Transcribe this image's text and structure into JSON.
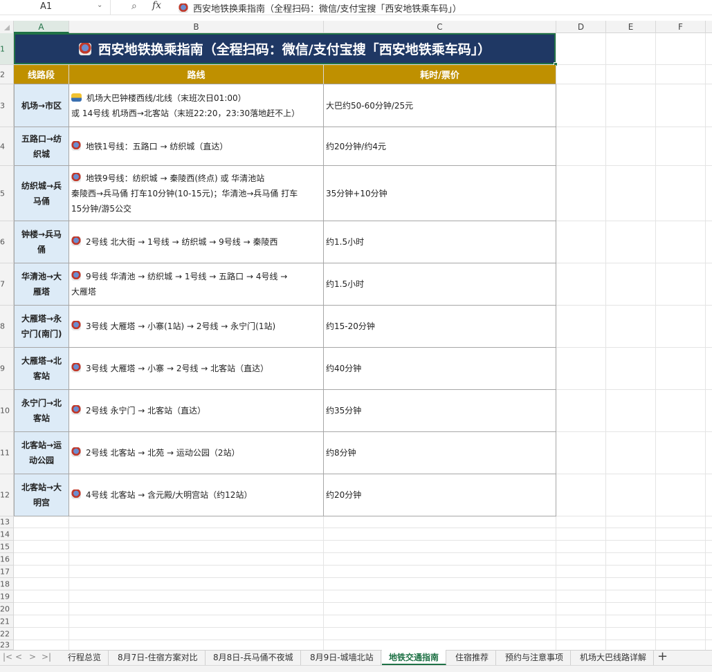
{
  "formula_bar": {
    "namebox": "A1",
    "zoom_icon": "⌕",
    "fx_label": "fx",
    "formula": "西安地铁换乘指南（全程扫码：微信/支付宝搜「西安地铁乘车码」）"
  },
  "columns": [
    "A",
    "B",
    "C",
    "D",
    "E",
    "F"
  ],
  "rows": [
    "1",
    "2",
    "3",
    "4",
    "5",
    "6",
    "7",
    "8",
    "9",
    "10",
    "11",
    "12",
    "13",
    "14",
    "15",
    "16",
    "17",
    "18",
    "19",
    "20",
    "21",
    "22",
    "23"
  ],
  "title": "西安地铁换乘指南（全程扫码：微信/支付宝搜「西安地铁乘车码」）",
  "headers": {
    "segment": "线路段",
    "route": "路线",
    "time_fare": "耗时/票价"
  },
  "table": [
    {
      "segment": [
        "机场→市区"
      ],
      "icon": "bus-icon",
      "route": [
        "机场大巴钟楼西线/北线（末班次日01:00）",
        "或 14号线 机场西→北客站（末班22:20，23:30落地赶不上）"
      ],
      "time_fare": "大巴约50-60分钟/25元"
    },
    {
      "segment": [
        "五路口→纺",
        "织城"
      ],
      "icon": "metro-icon",
      "route": [
        "地铁1号线：五路口 → 纺织城（直达）"
      ],
      "time_fare": "约20分钟/约4元"
    },
    {
      "segment": [
        "纺织城→兵",
        "马俑"
      ],
      "icon": "metro-icon",
      "route": [
        "地铁9号线：纺织城 → 秦陵西(终点) 或 华清池站",
        "秦陵西→兵马俑 打车10分钟(10-15元)；华清池→兵马俑 打车",
        "15分钟/游5公交"
      ],
      "time_fare": "35分钟+10分钟"
    },
    {
      "segment": [
        "钟楼→兵马",
        "俑"
      ],
      "icon": "metro-icon",
      "route": [
        "2号线 北大街 → 1号线 → 纺织城 → 9号线 → 秦陵西"
      ],
      "time_fare": "约1.5小时"
    },
    {
      "segment": [
        "华清池→大",
        "雁塔"
      ],
      "icon": "metro-icon",
      "route": [
        "9号线 华清池 → 纺织城 → 1号线 → 五路口 → 4号线 →",
        "大雁塔"
      ],
      "time_fare": "约1.5小时"
    },
    {
      "segment": [
        "大雁塔→永",
        "宁门(南门)"
      ],
      "icon": "metro-icon",
      "route": [
        "3号线 大雁塔 → 小寨(1站) → 2号线 → 永宁门(1站)"
      ],
      "time_fare": "约15-20分钟"
    },
    {
      "segment": [
        "大雁塔→北",
        "客站"
      ],
      "icon": "metro-icon",
      "route": [
        "3号线 大雁塔 → 小寨 → 2号线 → 北客站（直达）"
      ],
      "time_fare": "约40分钟"
    },
    {
      "segment": [
        "永宁门→北",
        "客站"
      ],
      "icon": "metro-icon",
      "route": [
        "2号线 永宁门 → 北客站（直达）"
      ],
      "time_fare": "约35分钟"
    },
    {
      "segment": [
        "北客站→运",
        "动公园"
      ],
      "icon": "metro-icon",
      "route": [
        "2号线 北客站 → 北苑 → 运动公园（2站）"
      ],
      "time_fare": "约8分钟"
    },
    {
      "segment": [
        "北客站→大",
        "明宫"
      ],
      "icon": "metro-icon",
      "route": [
        "4号线 北客站 → 含元殿/大明宫站（约12站）"
      ],
      "time_fare": "约20分钟"
    }
  ],
  "tabs": [
    "行程总览",
    "8月7日-住宿方案对比",
    "8月8日-兵马俑不夜城",
    "8月9日-城墙北站",
    "地铁交通指南",
    "住宿推荐",
    "预约与注意事项",
    "机场大巴线路详解"
  ],
  "active_tab": "地铁交通指南",
  "tab_nav": [
    "|<",
    "<",
    ">",
    ">|"
  ],
  "add_tab": "+"
}
